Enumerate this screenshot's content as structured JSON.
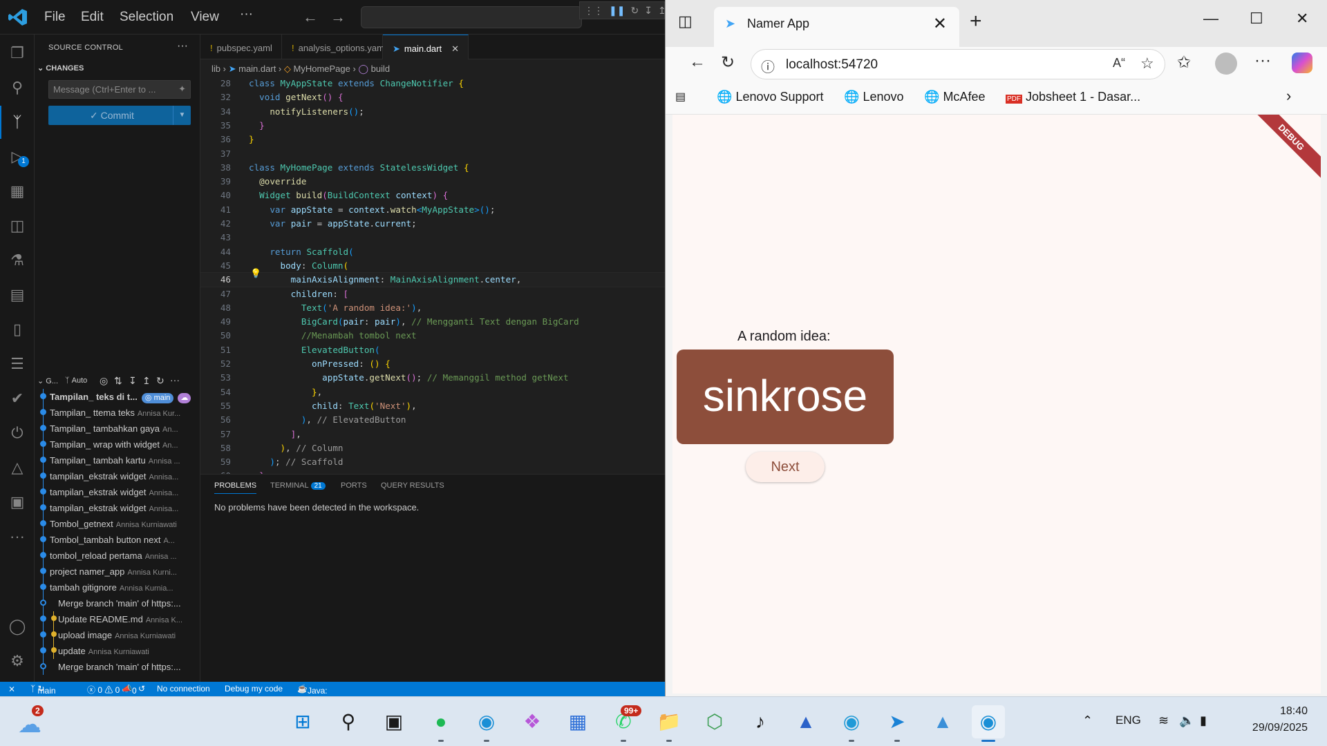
{
  "vscode": {
    "menu": [
      "File",
      "Edit",
      "Selection",
      "View",
      "···"
    ],
    "sidebar": {
      "title": "SOURCE CONTROL",
      "changes_label": "CHANGES",
      "message_placeholder": "Message (Ctrl+Enter to ...",
      "commit_label": "✓ Commit",
      "graph_header": "G...",
      "graph_auto": "Auto",
      "commits": [
        {
          "msg": "Tampilan_ teks di t...",
          "author": "",
          "head": true,
          "branch_badge": "main"
        },
        {
          "msg": "Tampilan_ ttema teks",
          "author": "Annisa Kur..."
        },
        {
          "msg": "Tampilan_ tambahkan gaya",
          "author": "An..."
        },
        {
          "msg": "Tampilan_ wrap with widget",
          "author": "An..."
        },
        {
          "msg": "Tampilan_ tambah kartu",
          "author": "Annisa ..."
        },
        {
          "msg": "tampilan_ekstrak widget",
          "author": "Annisa..."
        },
        {
          "msg": "tampilan_ekstrak widget",
          "author": "Annisa..."
        },
        {
          "msg": "tampilan_ekstrak widget",
          "author": "Annisa..."
        },
        {
          "msg": "Tombol_getnext",
          "author": "Annisa Kurniawati"
        },
        {
          "msg": "Tombol_tambah button next",
          "author": "A..."
        },
        {
          "msg": "tombol_reload pertama",
          "author": "Annisa ..."
        },
        {
          "msg": "project namer_app",
          "author": "Annisa Kurni..."
        },
        {
          "msg": "tambah gitignore",
          "author": "Annisa Kurnia..."
        },
        {
          "msg": "Merge branch 'main' of https:...",
          "author": "",
          "kind": "merge"
        },
        {
          "msg": "Update README.md",
          "author": "Annisa K...",
          "kind": "branch"
        },
        {
          "msg": "upload image",
          "author": "Annisa Kurniawati",
          "kind": "branch"
        },
        {
          "msg": "update",
          "author": "Annisa Kurniawati",
          "kind": "branch"
        },
        {
          "msg": "Merge branch 'main' of https:...",
          "author": "",
          "kind": "merge"
        }
      ]
    },
    "tabs": [
      {
        "label": "pubspec.yaml",
        "modified": true
      },
      {
        "label": "analysis_options.yaml",
        "modified": true
      },
      {
        "label": "main.dart",
        "modified": false,
        "active": true
      }
    ],
    "breadcrumb": [
      "lib",
      "main.dart",
      "MyHomePage",
      "build"
    ],
    "code_lines": [
      {
        "n": "28",
        "html": "<span class='kw'>class</span> <span class='cls'>MyAppState</span> <span class='kw'>extends</span> <span class='cls'>ChangeNotifier</span> <span class='br2'>{</span>"
      },
      {
        "n": "32",
        "html": "  <span class='kw'>void</span> <span class='fn'>getNext</span><span class='br1'>()</span> <span class='br1'>{</span>"
      },
      {
        "n": "34",
        "html": "    <span class='fn'>notifyListeners</span><span class='br3'>()</span>;"
      },
      {
        "n": "35",
        "html": "  <span class='br1'>}</span>"
      },
      {
        "n": "36",
        "html": "<span class='br2'>}</span>"
      },
      {
        "n": "37",
        "html": ""
      },
      {
        "n": "38",
        "html": "<span class='kw'>class</span> <span class='cls'>MyHomePage</span> <span class='kw'>extends</span> <span class='cls'>StatelessWidget</span> <span class='br2'>{</span>"
      },
      {
        "n": "39",
        "html": "  <span class='fn'>@override</span>"
      },
      {
        "n": "40",
        "html": "  <span class='cls'>Widget</span> <span class='fn'>build</span><span class='br1'>(</span><span class='cls'>BuildContext</span> <span class='vr'>context</span><span class='br1'>)</span> <span class='br1'>{</span>"
      },
      {
        "n": "41",
        "html": "    <span class='kw'>var</span> <span class='vr'>appState</span> = <span class='vr'>context</span>.<span class='fn'>watch</span><span class='br3'>&lt;</span><span class='cls'>MyAppState</span><span class='br3'>&gt;()</span>;"
      },
      {
        "n": "42",
        "html": "    <span class='kw'>var</span> <span class='vr'>pair</span> = <span class='vr'>appState</span>.<span class='vr'>current</span>;"
      },
      {
        "n": "43",
        "html": ""
      },
      {
        "n": "44",
        "html": "    <span class='kw'>return</span> <span class='cls'>Scaffold</span><span class='br3'>(</span>"
      },
      {
        "n": "45",
        "html": "      <span class='vr'>body</span>: <span class='cls'>Column</span><span class='br2'>(</span>"
      },
      {
        "n": "46",
        "html": "        <span class='vr'>mainAxisAlignment</span>: <span class='cls'>MainAxisAlignment</span>.<span class='vr'>center</span>,"
      },
      {
        "n": "47",
        "html": "        <span class='vr'>children</span>: <span class='br1'>[</span>"
      },
      {
        "n": "48",
        "html": "          <span class='cls'>Text</span><span class='br3'>(</span><span class='str'>'A random idea:'</span><span class='br3'>)</span>,"
      },
      {
        "n": "49",
        "html": "          <span class='cls'>BigCard</span><span class='br3'>(</span><span class='vr'>pair</span>: <span class='vr'>pair</span><span class='br3'>)</span>, <span class='cm'>// Mengganti Text dengan BigCard</span>"
      },
      {
        "n": "50",
        "html": "          <span class='cm'>//Menambah tombol next</span>"
      },
      {
        "n": "51",
        "html": "          <span class='cls'>ElevatedButton</span><span class='br3'>(</span>"
      },
      {
        "n": "52",
        "html": "            <span class='vr'>onPressed</span>: <span class='br2'>()</span> <span class='br2'>{</span>"
      },
      {
        "n": "53",
        "html": "              <span class='vr'>appState</span>.<span class='fn'>getNext</span><span class='br1'>()</span>; <span class='cm'>// Memanggil method getNext</span>"
      },
      {
        "n": "54",
        "html": "            <span class='br2'>}</span>,"
      },
      {
        "n": "55",
        "html": "            <span class='vr'>child</span>: <span class='cls'>Text</span><span class='br2'>(</span><span class='str'>'Next'</span><span class='br2'>)</span>,"
      },
      {
        "n": "56",
        "html": "          <span class='br3'>)</span>, <span class='cm2'>// ElevatedButton</span>"
      },
      {
        "n": "57",
        "html": "        <span class='br1'>]</span>,"
      },
      {
        "n": "58",
        "html": "      <span class='br2'>)</span>, <span class='cm2'>// Column</span>"
      },
      {
        "n": "59",
        "html": "    <span class='br3'>)</span>; <span class='cm2'>// Scaffold</span>"
      },
      {
        "n": "60",
        "html": "  <span class='br1'>}</span>"
      }
    ],
    "panel": {
      "tabs": [
        "PROBLEMS",
        "TERMINAL",
        "PORTS",
        "QUERY RESULTS"
      ],
      "terminal_count": "21",
      "message": "No problems have been detected in the workspace."
    },
    "status": {
      "branch": "main",
      "problems": "ⓧ 0 ⚠ 0",
      "ports": "0",
      "connection": "No connection",
      "debug": "Debug my code",
      "java": "Java: Ready"
    },
    "debug_badge": "1"
  },
  "browser": {
    "tab_title": "Namer App",
    "url": "localhost:54720",
    "favorites": [
      "Lenovo Support",
      "Lenovo",
      "McAfee",
      "Jobsheet 1 - Dasar..."
    ],
    "app": {
      "debug_banner": "DEBUG",
      "label": "A random idea:",
      "word": "sinkrose",
      "button": "Next"
    }
  },
  "taskbar": {
    "weather_badge": "2",
    "whatsapp_badge": "99+",
    "lang": "ENG",
    "time": "18:40",
    "date": "29/09/2025"
  },
  "colors": {
    "vscode_accent": "#0078d4",
    "card": "#8d4e3b",
    "page_bg": "#fef7f5"
  }
}
